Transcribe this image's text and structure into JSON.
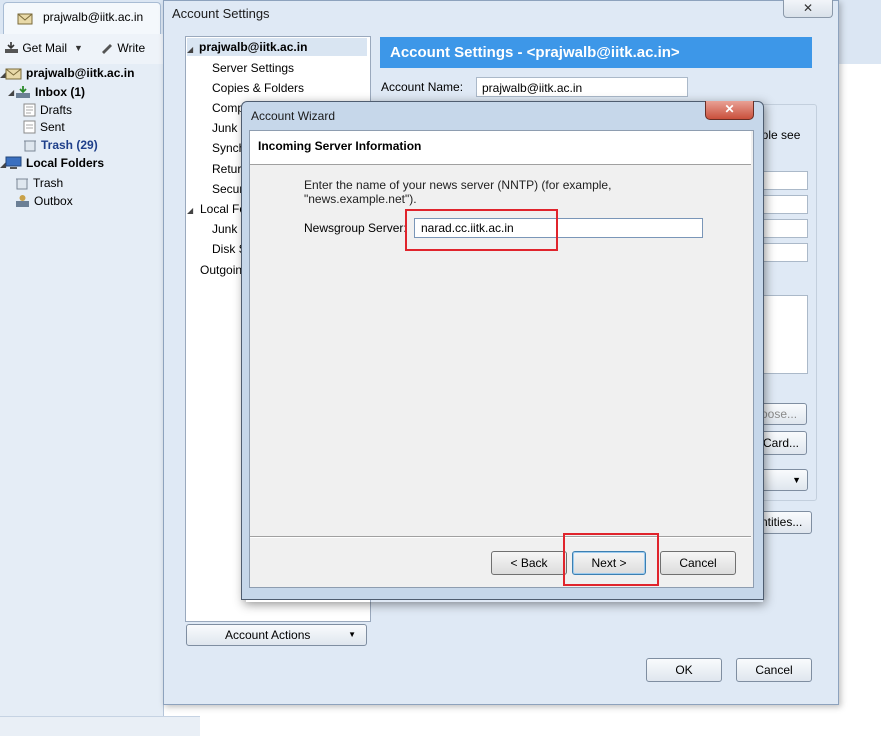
{
  "thunderbird": {
    "tab_title": "prajwalb@iitk.ac.in",
    "toolbar": {
      "get_mail": "Get Mail",
      "write": "Write"
    },
    "folders": {
      "account": "prajwalb@iitk.ac.in",
      "inbox": "Inbox (1)",
      "drafts": "Drafts",
      "sent": "Sent",
      "trash": "Trash (29)",
      "local_folders": "Local Folders",
      "local_trash": "Trash",
      "outbox": "Outbox"
    }
  },
  "account_settings": {
    "window_title": "Account Settings",
    "close_label": "✕",
    "tree": {
      "account": "prajwalb@iitk.ac.in",
      "server_settings": "Server Settings",
      "copies_folders": "Copies & Folders",
      "composition": "Comp",
      "junk": "Junk",
      "sync": "Synch",
      "return": "Retur",
      "security": "Secur",
      "local_folders": "Local Fo",
      "local_junk": "Junk",
      "disk_space": "Disk S",
      "outgoing": "Outgoin"
    },
    "account_actions_label": "Account Actions",
    "header": "Account Settings - <prajwalb@iitk.ac.in>",
    "account_name_label": "Account Name:",
    "account_name_value": "prajwalb@iitk.ac.in",
    "fragments": {
      "people_see": "ople see",
      "choose": "oose...",
      "attach_card": "Card...",
      "identities": "ntities..."
    },
    "ok_label": "OK",
    "cancel_label": "Cancel"
  },
  "wizard": {
    "title": "Account Wizard",
    "close_label": "✕",
    "page_title": "Incoming Server Information",
    "description_line1": "Enter the name of your news server (NNTP) (for example,",
    "description_line2": "\"news.example.net\").",
    "server_label": "Newsgroup Server:",
    "server_value": "narad.cc.iitk.ac.in",
    "back_label": "< Back",
    "next_label": "Next >",
    "cancel_label": "Cancel"
  },
  "colors": {
    "header_blue": "#3d97e8",
    "window_bg": "#dfe9f5",
    "highlight_red": "#e0242c"
  }
}
